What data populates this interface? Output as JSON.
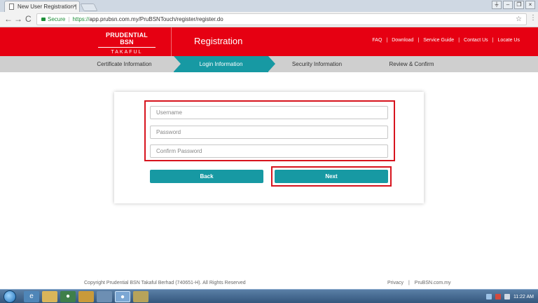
{
  "browser": {
    "tab_title": "New User Registration |",
    "tab_close": "×",
    "window_buttons": [
      "⏚",
      "–",
      "❐",
      "×"
    ],
    "nav_back": "←",
    "nav_forward": "→",
    "nav_reload": "C",
    "secure_label": "Secure",
    "url_protocol": "https://",
    "url_rest": "app.prubsn.com.my/PruBSNTouch/register/register.do",
    "bookmark_icon": "☆",
    "menu_icon": "⋮"
  },
  "header": {
    "logo_top": "PRUDENTIAL BSN",
    "logo_bottom": "TAKAFUL",
    "title": "Registration",
    "links": [
      "FAQ",
      "Download",
      "Service Guide",
      "Contact Us",
      "Locate Us"
    ],
    "link_separator": "|"
  },
  "steps": [
    {
      "label": "Certificate Information"
    },
    {
      "label": "Login Information"
    },
    {
      "label": "Security Information"
    },
    {
      "label": "Review & Confirm"
    }
  ],
  "form": {
    "username_placeholder": "Username",
    "password_placeholder": "Password",
    "confirm_placeholder": "Confirm Password",
    "back_label": "Back",
    "next_label": "Next"
  },
  "footer": {
    "copyright": "Copyright Prudential BSN Takaful Berhad (740651-H). All Rights Reserved",
    "privacy": "Privacy",
    "separator": "|",
    "site": "PruBSN.com.my"
  },
  "taskbar": {
    "clock": "11:22 AM"
  },
  "colors": {
    "brand_red": "#e60012",
    "accent_teal": "#1799a3",
    "highlight_red": "#d7141e"
  }
}
